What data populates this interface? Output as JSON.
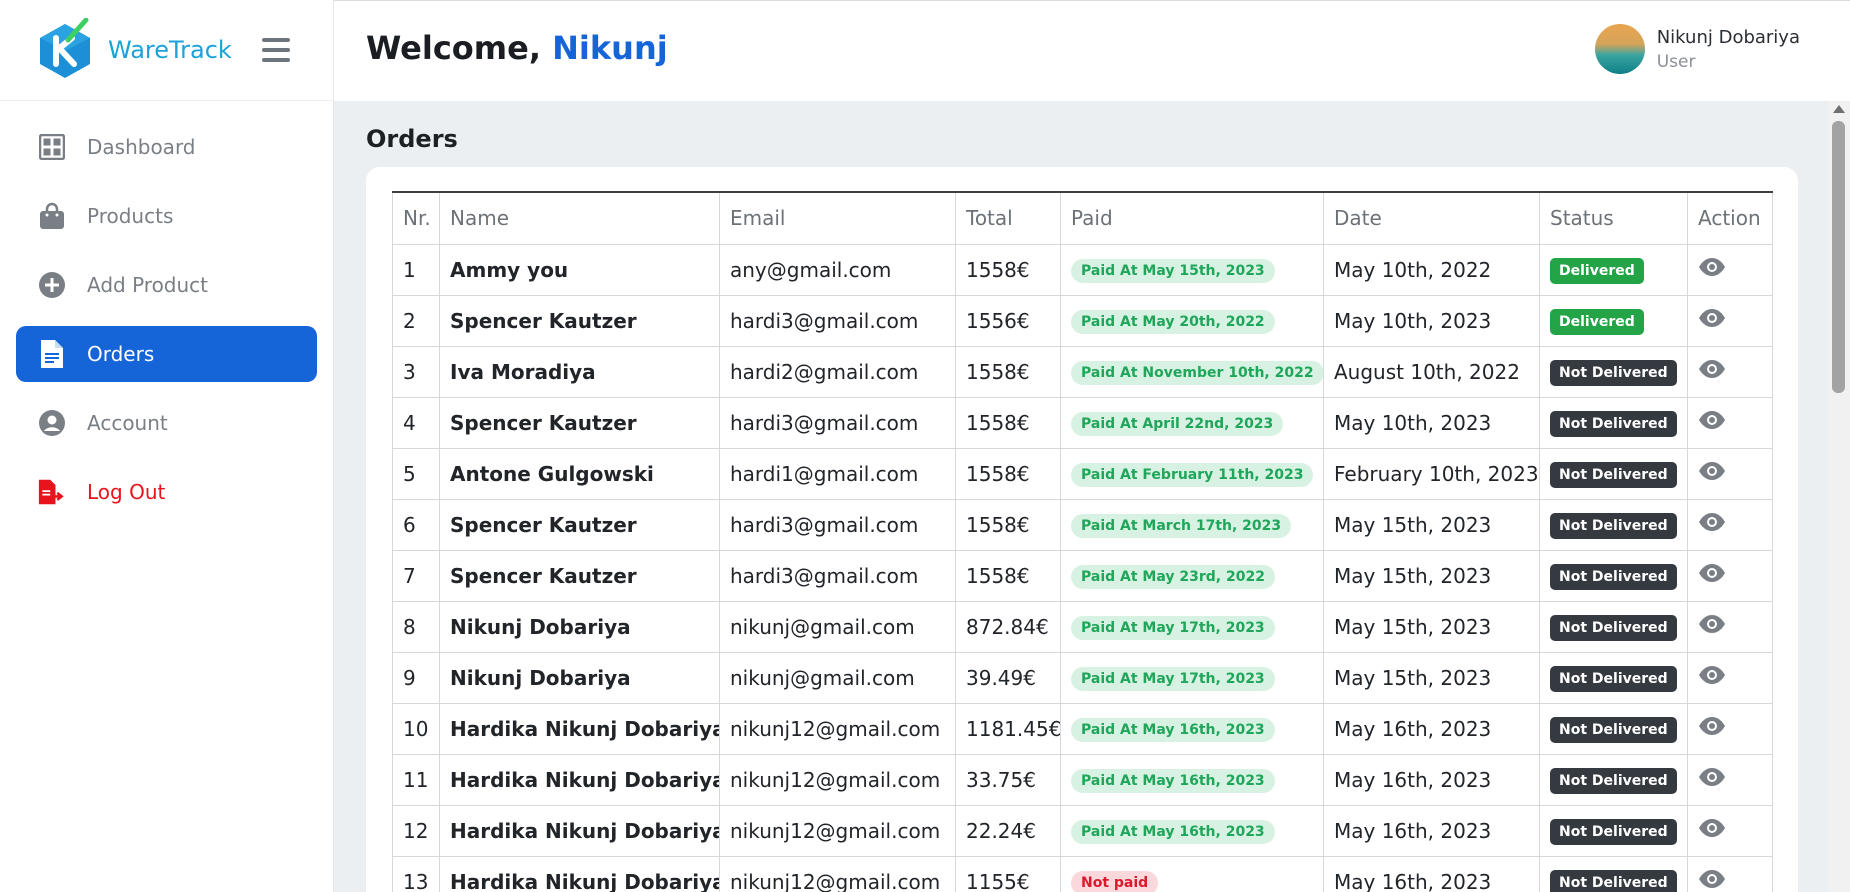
{
  "brand": {
    "name": "WareTrack"
  },
  "sidebar": {
    "items": [
      {
        "label": "Dashboard",
        "icon": "dashboard-grid-icon",
        "active": false
      },
      {
        "label": "Products",
        "icon": "shopping-bag-icon",
        "active": false
      },
      {
        "label": "Add Product",
        "icon": "plus-circle-icon",
        "active": false
      },
      {
        "label": "Orders",
        "icon": "document-icon",
        "active": true
      },
      {
        "label": "Account",
        "icon": "user-circle-icon",
        "active": false
      },
      {
        "label": "Log Out",
        "icon": "logout-icon",
        "active": false
      }
    ]
  },
  "header": {
    "welcome_prefix": "Welcome,",
    "welcome_name": "Nikunj",
    "user_name": "Nikunj Dobariya",
    "user_role": "User"
  },
  "orders": {
    "heading": "Orders",
    "columns": [
      "Nr.",
      "Name",
      "Email",
      "Total",
      "Paid",
      "Date",
      "Status",
      "Action"
    ],
    "rows": [
      {
        "nr": "1",
        "name": "Ammy you",
        "email": "any@gmail.com",
        "total": "1558€",
        "paid": "Paid At May 15th, 2023",
        "paid_ok": true,
        "date": "May 10th, 2022",
        "status": "Delivered",
        "delivered": true
      },
      {
        "nr": "2",
        "name": "Spencer Kautzer",
        "email": "hardi3@gmail.com",
        "total": "1556€",
        "paid": "Paid At May 20th, 2022",
        "paid_ok": true,
        "date": "May 10th, 2023",
        "status": "Delivered",
        "delivered": true
      },
      {
        "nr": "3",
        "name": "Iva Moradiya",
        "email": "hardi2@gmail.com",
        "total": "1558€",
        "paid": "Paid At November 10th, 2022",
        "paid_ok": true,
        "date": "August 10th, 2022",
        "status": "Not Delivered",
        "delivered": false
      },
      {
        "nr": "4",
        "name": "Spencer Kautzer",
        "email": "hardi3@gmail.com",
        "total": "1558€",
        "paid": "Paid At April 22nd, 2023",
        "paid_ok": true,
        "date": "May 10th, 2023",
        "status": "Not Delivered",
        "delivered": false
      },
      {
        "nr": "5",
        "name": "Antone Gulgowski",
        "email": "hardi1@gmail.com",
        "total": "1558€",
        "paid": "Paid At February 11th, 2023",
        "paid_ok": true,
        "date": "February 10th, 2023",
        "status": "Not Delivered",
        "delivered": false
      },
      {
        "nr": "6",
        "name": "Spencer Kautzer",
        "email": "hardi3@gmail.com",
        "total": "1558€",
        "paid": "Paid At March 17th, 2023",
        "paid_ok": true,
        "date": "May 15th, 2023",
        "status": "Not Delivered",
        "delivered": false
      },
      {
        "nr": "7",
        "name": "Spencer Kautzer",
        "email": "hardi3@gmail.com",
        "total": "1558€",
        "paid": "Paid At May 23rd, 2022",
        "paid_ok": true,
        "date": "May 15th, 2023",
        "status": "Not Delivered",
        "delivered": false
      },
      {
        "nr": "8",
        "name": "Nikunj Dobariya",
        "email": "nikunj@gmail.com",
        "total": "872.84€",
        "paid": "Paid At May 17th, 2023",
        "paid_ok": true,
        "date": "May 15th, 2023",
        "status": "Not Delivered",
        "delivered": false
      },
      {
        "nr": "9",
        "name": "Nikunj Dobariya",
        "email": "nikunj@gmail.com",
        "total": "39.49€",
        "paid": "Paid At May 17th, 2023",
        "paid_ok": true,
        "date": "May 15th, 2023",
        "status": "Not Delivered",
        "delivered": false
      },
      {
        "nr": "10",
        "name": "Hardika Nikunj Dobariya",
        "email": "nikunj12@gmail.com",
        "total": "1181.45€",
        "paid": "Paid At May 16th, 2023",
        "paid_ok": true,
        "date": "May 16th, 2023",
        "status": "Not Delivered",
        "delivered": false
      },
      {
        "nr": "11",
        "name": "Hardika Nikunj Dobariya",
        "email": "nikunj12@gmail.com",
        "total": "33.75€",
        "paid": "Paid At May 16th, 2023",
        "paid_ok": true,
        "date": "May 16th, 2023",
        "status": "Not Delivered",
        "delivered": false
      },
      {
        "nr": "12",
        "name": "Hardika Nikunj Dobariya",
        "email": "nikunj12@gmail.com",
        "total": "22.24€",
        "paid": "Paid At May 16th, 2023",
        "paid_ok": true,
        "date": "May 16th, 2023",
        "status": "Not Delivered",
        "delivered": false
      },
      {
        "nr": "13",
        "name": "Hardika Nikunj Dobariya",
        "email": "nikunj12@gmail.com",
        "total": "1155€",
        "paid": "Not paid",
        "paid_ok": false,
        "date": "May 16th, 2023",
        "status": "Not Delivered",
        "delivered": false
      }
    ]
  },
  "colors": {
    "accent": "#1565d8",
    "brand": "#1aa3d8",
    "logout": "#e8141c",
    "paid_bg": "#d7f2e2",
    "paid_text": "#1fa65a",
    "unpaid_bg": "#fbd8dc",
    "unpaid_text": "#d91a2c",
    "delivered": "#22a447",
    "not_delivered": "#343a40"
  }
}
